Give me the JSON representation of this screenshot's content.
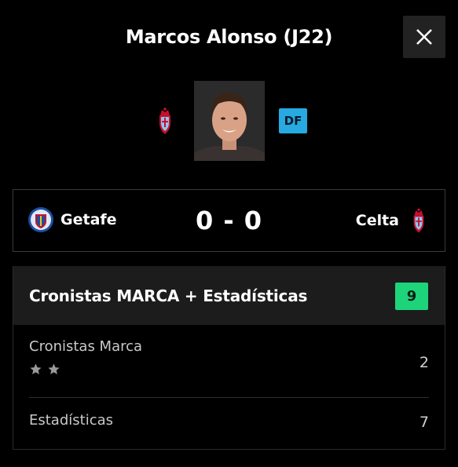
{
  "header": {
    "title": "Marcos Alonso (J22)",
    "close_icon": "close-icon"
  },
  "player": {
    "team_crest_icon": "celta-crest-icon",
    "position": "DF"
  },
  "match": {
    "home_team": "Getafe",
    "home_crest_icon": "getafe-crest-icon",
    "score": "0 - 0",
    "away_team": "Celta",
    "away_crest_icon": "celta-crest-icon"
  },
  "rating": {
    "title": "Cronistas MARCA + Estadísticas",
    "total": "9",
    "total_color": "#1ed47a",
    "rows": [
      {
        "label": "Cronistas Marca",
        "value": "2",
        "stars": 2
      },
      {
        "label": "Estadísticas",
        "value": "7"
      }
    ]
  },
  "colors": {
    "background": "#000000",
    "position_badge": "#27a9e1",
    "rating_badge": "#1ed47a"
  }
}
